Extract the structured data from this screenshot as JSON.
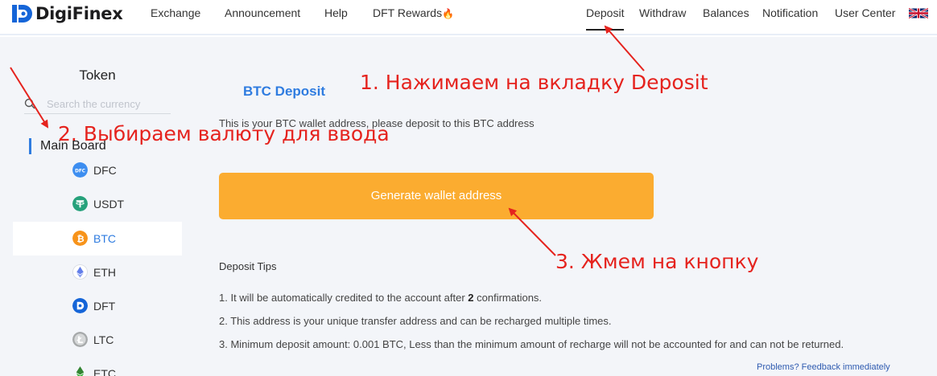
{
  "header": {
    "logo_text": "DigiFinex",
    "nav_left": [
      "Exchange",
      "Announcement",
      "Help",
      "DFT Rewards"
    ],
    "nav_right": [
      "Deposit",
      "Withdraw",
      "Balances",
      "Notification",
      "User Center"
    ],
    "active_tab": "Deposit",
    "fire_icon": "fire-icon",
    "flag_icon": "uk-flag-icon"
  },
  "sidebar": {
    "title": "Token",
    "search_placeholder": "Search the currency",
    "board_label": "Main Board",
    "coins": [
      {
        "label": "DFC",
        "icon": "dfc-coin-icon",
        "color": "#3d8ef0"
      },
      {
        "label": "USDT",
        "icon": "usdt-coin-icon",
        "color": "#26a17b"
      },
      {
        "label": "BTC",
        "icon": "btc-coin-icon",
        "color": "#f7931a",
        "selected": true
      },
      {
        "label": "ETH",
        "icon": "eth-coin-icon",
        "color": "#627eea"
      },
      {
        "label": "DFT",
        "icon": "dft-coin-icon",
        "color": "#1565d8"
      },
      {
        "label": "LTC",
        "icon": "ltc-coin-icon",
        "color": "#a6a9aa"
      },
      {
        "label": "ETC",
        "icon": "etc-coin-icon",
        "color": "#328432"
      }
    ]
  },
  "main": {
    "title": "BTC Deposit",
    "description": "This is your BTC wallet address, please deposit to this BTC address",
    "button_label": "Generate wallet address",
    "tips_title": "Deposit Tips",
    "tip1_pre": "1. It will be automatically credited to the account after ",
    "tip1_bold": "2",
    "tip1_post": " confirmations.",
    "tip2": "2. This address is your unique transfer address and can be recharged multiple times.",
    "tip3": "3. Minimum deposit amount: 0.001 BTC, Less than the minimum amount of recharge will not be accounted for and can not be returned.",
    "feedback_link": "Problems? Feedback immediately"
  },
  "annotations": {
    "step1": "1. Нажимаем на вкладку Deposit",
    "step2": "2. Выбираем валюту для ввода",
    "step3": "3. Жмем на кнопку",
    "color": "#e5231e"
  },
  "colors": {
    "accent": "#2f7ce0",
    "button": "#fbac30",
    "panel_bg": "#f3f5f9"
  }
}
